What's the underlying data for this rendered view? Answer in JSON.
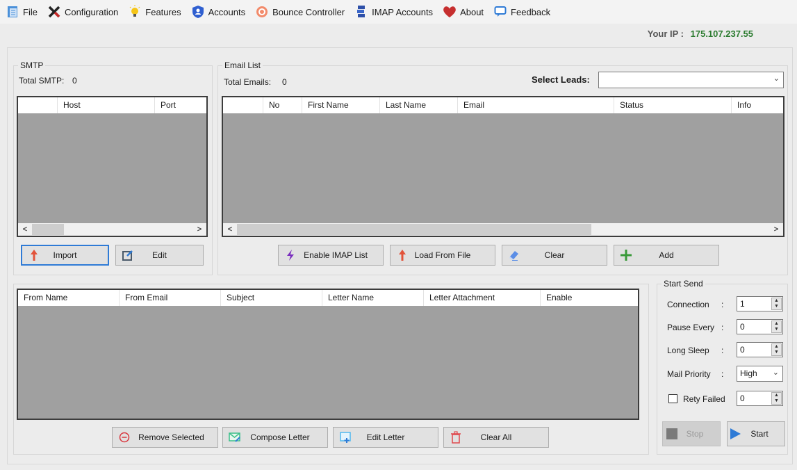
{
  "menu": {
    "items": [
      {
        "label": "File",
        "icon": "file-icon"
      },
      {
        "label": "Configuration",
        "icon": "tools-icon"
      },
      {
        "label": "Features",
        "icon": "lightbulb-icon"
      },
      {
        "label": "Accounts",
        "icon": "user-shield-icon"
      },
      {
        "label": "Bounce Controller",
        "icon": "bounce-icon"
      },
      {
        "label": "IMAP Accounts",
        "icon": "servers-icon"
      },
      {
        "label": "About",
        "icon": "heart-icon"
      },
      {
        "label": "Feedback",
        "icon": "chat-icon"
      }
    ]
  },
  "ip": {
    "label": "Your IP :",
    "value": "175.107.237.55",
    "color": "#2e7d32"
  },
  "smtp": {
    "title": "SMTP",
    "total_label": "Total SMTP:",
    "total_value": "0",
    "columns": [
      "",
      "Host",
      "Port"
    ],
    "import_label": "Import",
    "edit_label": "Edit"
  },
  "email_list": {
    "title": "Email List",
    "total_label": "Total Emails:",
    "total_value": "0",
    "select_leads_label": "Select Leads:",
    "select_leads_value": "",
    "columns": [
      "",
      "No",
      "First Name",
      "Last Name",
      "Email",
      "Status",
      "Info"
    ],
    "buttons": {
      "enable_imap": "Enable IMAP List",
      "load_file": "Load From File",
      "clear": "Clear",
      "add": "Add"
    }
  },
  "letters": {
    "columns": [
      "From Name",
      "From Email",
      "Subject",
      "Letter Name",
      "Letter Attachment",
      "Enable"
    ],
    "buttons": {
      "remove_selected": "Remove Selected",
      "compose": "Compose Letter",
      "edit": "Edit Letter",
      "clear_all": "Clear All"
    }
  },
  "start_send": {
    "title": "Start Send",
    "connection_label": "Connection",
    "connection_value": "1",
    "pause_label": "Pause Every",
    "pause_value": "0",
    "sleep_label": "Long Sleep",
    "sleep_value": "0",
    "priority_label": "Mail Priority",
    "priority_value": "High",
    "retry_label": "Rety Failed",
    "retry_checked": false,
    "retry_value": "0",
    "colon": ":",
    "stop_label": "Stop",
    "start_label": "Start"
  }
}
